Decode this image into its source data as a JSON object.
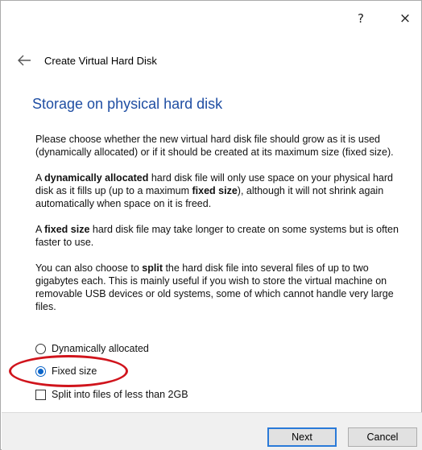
{
  "titlebar": {
    "help_label": "?",
    "close_label": "×"
  },
  "header": {
    "back_icon": "arrow-left",
    "title": "Create Virtual Hard Disk"
  },
  "page": {
    "title": "Storage on physical hard disk",
    "paragraphs": [
      {
        "parts": [
          "Please choose whether the new virtual hard disk file should grow as it is used (dynamically allocated) or if it should be created at its maximum size (fixed size)."
        ]
      },
      {
        "parts": [
          "A ",
          "dynamically allocated",
          " hard disk file will only use space on your physical hard disk as it fills up (up to a maximum ",
          "fixed size",
          "), although it will not shrink again automatically when space on it is freed."
        ]
      },
      {
        "parts": [
          "A ",
          "fixed size",
          " hard disk file may take longer to create on some systems but is often faster to use."
        ]
      },
      {
        "parts": [
          "You can also choose to ",
          "split",
          " the hard disk file into several files of up to two gigabytes each. This is mainly useful if you wish to store the virtual machine on removable USB devices or old systems, some of which cannot handle very large files."
        ]
      }
    ]
  },
  "options": {
    "dynamic_label": "Dynamically allocated",
    "dynamic_checked": false,
    "fixed_label": "Fixed size",
    "fixed_checked": true,
    "split_label": "Split into files of less than 2GB",
    "split_checked": false
  },
  "footer": {
    "next_label": "Next",
    "cancel_label": "Cancel"
  },
  "colors": {
    "title_blue": "#1f4ea3",
    "annotation_red": "#d0141c",
    "accent_blue": "#0a64c8"
  }
}
